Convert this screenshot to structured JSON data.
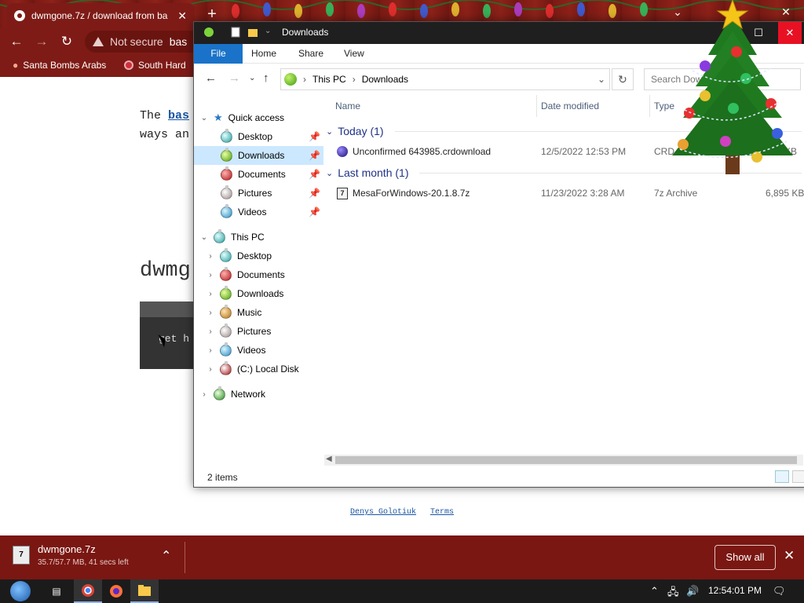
{
  "browser": {
    "tab_title": "dwmgone.7z / download from ba",
    "address": "Not secure",
    "address_text": "bas",
    "bookmarks": [
      "Santa Bombs Arabs",
      "South Hard"
    ]
  },
  "page": {
    "para_line1_prefix": "The ",
    "para_link": "bas",
    "para_line2": "ways an",
    "heading": "dwmg",
    "codebox_text": "get h",
    "footer_author": "Denys Golotiuk",
    "footer_terms": "Terms"
  },
  "download_shelf": {
    "file_name": "dwmgone.7z",
    "progress_text": "35.7/57.7 MB, 41 secs left",
    "show_all": "Show all"
  },
  "explorer": {
    "title": "Downloads",
    "ribbon_tabs": [
      "File",
      "Home",
      "Share",
      "View"
    ],
    "breadcrumb": [
      "This PC",
      "Downloads"
    ],
    "search_placeholder": "Search Downloads",
    "nav": {
      "quick_access": "Quick access",
      "quick_items": [
        "Desktop",
        "Downloads",
        "Documents",
        "Pictures",
        "Videos"
      ],
      "this_pc": "This PC",
      "pc_items": [
        "Desktop",
        "Documents",
        "Downloads",
        "Music",
        "Pictures",
        "Videos",
        "(C:) Local Disk"
      ],
      "network": "Network"
    },
    "columns": [
      "Name",
      "Date modified",
      "Type"
    ],
    "groups": [
      {
        "label": "Today (1)",
        "files": [
          {
            "name": "Unconfirmed 643985.crdownload",
            "date": "12/5/2022 12:53 PM",
            "type": "CRD",
            "size": "KB"
          }
        ]
      },
      {
        "label": "Last month (1)",
        "files": [
          {
            "name": "MesaForWindows-20.1.8.7z",
            "date": "11/23/2022 3:28 AM",
            "type": "7z Archive",
            "size": "6,895 KB"
          }
        ]
      }
    ],
    "status": "2 items"
  },
  "taskbar": {
    "clock": "12:54:01 PM"
  },
  "colors": {
    "browser_chrome": "#7e1b16",
    "explorer_file_tab": "#1a73c9",
    "group_header": "#1e3287",
    "selection": "#cce8ff",
    "close_red": "#e81123"
  }
}
